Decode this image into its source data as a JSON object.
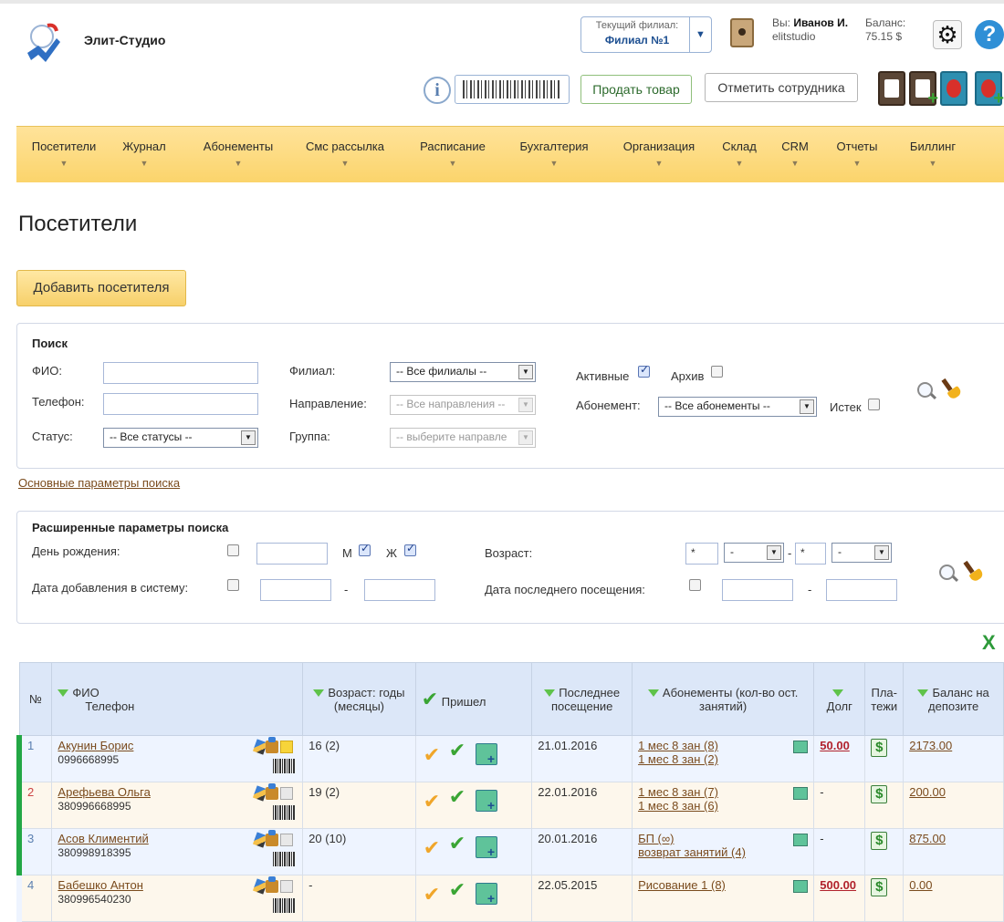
{
  "app": {
    "title": "Элит-Студио"
  },
  "branch": {
    "label": "Текущий филиал:",
    "value": "Филиал №1"
  },
  "user": {
    "prefix": "Вы:",
    "name": "Иванов И.",
    "login": "elitstudio"
  },
  "balance": {
    "label": "Баланс:",
    "value": "75.15 $"
  },
  "toolbar": {
    "sell_label": "Продать товар",
    "mark_label": "Отметить сотрудника"
  },
  "nav": {
    "items": [
      "Посетители",
      "Журнал",
      "Абонементы",
      "Смс рассылка",
      "Расписание",
      "Бухгалтерия",
      "Организация",
      "Склад",
      "CRM",
      "Отчеты",
      "Биллинг"
    ]
  },
  "page": {
    "title": "Посетители",
    "add_label": "Добавить посетителя"
  },
  "search": {
    "heading": "Поиск",
    "fio_label": "ФИО:",
    "phone_label": "Телефон:",
    "status_label": "Статус:",
    "status_value": "-- Все статусы --",
    "branch_label": "Филиал:",
    "branch_value": "-- Все филиалы --",
    "direction_label": "Направление:",
    "direction_value": "-- Все направления --",
    "group_label": "Группа:",
    "group_value": "-- выберите направле",
    "active_label": "Активные",
    "archive_label": "Архив",
    "subscription_label": "Абонемент:",
    "subscription_value": "-- Все абонементы --",
    "expired_label": "Истек",
    "basic_link": "Основные параметры поиска"
  },
  "advanced": {
    "heading": "Расширенные параметры поиска",
    "birthday_label": "День рождения:",
    "male_label": "М",
    "female_label": "Ж",
    "age_label": "Возраст:",
    "age_from": "*",
    "age_from_unit": "-",
    "age_to": "*",
    "age_to_unit": "-",
    "dash": "-",
    "added_label": "Дата добавления в систему:",
    "last_visit_label": "Дата последнего посещения:"
  },
  "table": {
    "headers": {
      "num": "№",
      "fio": "ФИО",
      "phone": "Телефон",
      "age": "Возраст: годы (месяцы)",
      "came": "Пришел",
      "last_visit": "Последнее посещение",
      "subscriptions": "Абонементы (кол-во ост. занятий)",
      "debt": "Долг",
      "payments": "Пла-тежи",
      "deposit": "Баланс на депозите"
    },
    "rows": [
      {
        "num": "1",
        "name": "Акунин Борис",
        "phone": "0996668995",
        "age": "16 (2)",
        "last_visit": "21.01.2016",
        "subs": [
          "1 мес 8 зан (8)",
          "1 мес 8 зан (2)"
        ],
        "debt": "50.00",
        "deposit": "2173.00"
      },
      {
        "num": "2",
        "name": "Арефьева Ольга",
        "phone": "380996668995",
        "age": "19 (2)",
        "last_visit": "22.01.2016",
        "subs": [
          "1 мес 8 зан (7)",
          "1 мес 8 зан (6)"
        ],
        "debt": "-",
        "deposit": "200.00"
      },
      {
        "num": "3",
        "name": "Асов Климентий",
        "phone": "380998918395",
        "age": "20 (10)",
        "last_visit": "20.01.2016",
        "subs": [
          "БП (∞)",
          "возврат занятий (4)"
        ],
        "debt": "-",
        "deposit": "875.00"
      },
      {
        "num": "4",
        "name": "Бабешко Антон",
        "phone": "380996540230",
        "age": "-",
        "last_visit": "22.05.2015",
        "subs": [
          "Рисование 1 (8)",
          ""
        ],
        "debt": "500.00",
        "deposit": "0.00"
      }
    ]
  },
  "colors": {
    "nav_bg": "#fbd46b",
    "accent_green": "#23a745",
    "header_blue": "#dce7f8",
    "debt_red": "#b1222c"
  }
}
